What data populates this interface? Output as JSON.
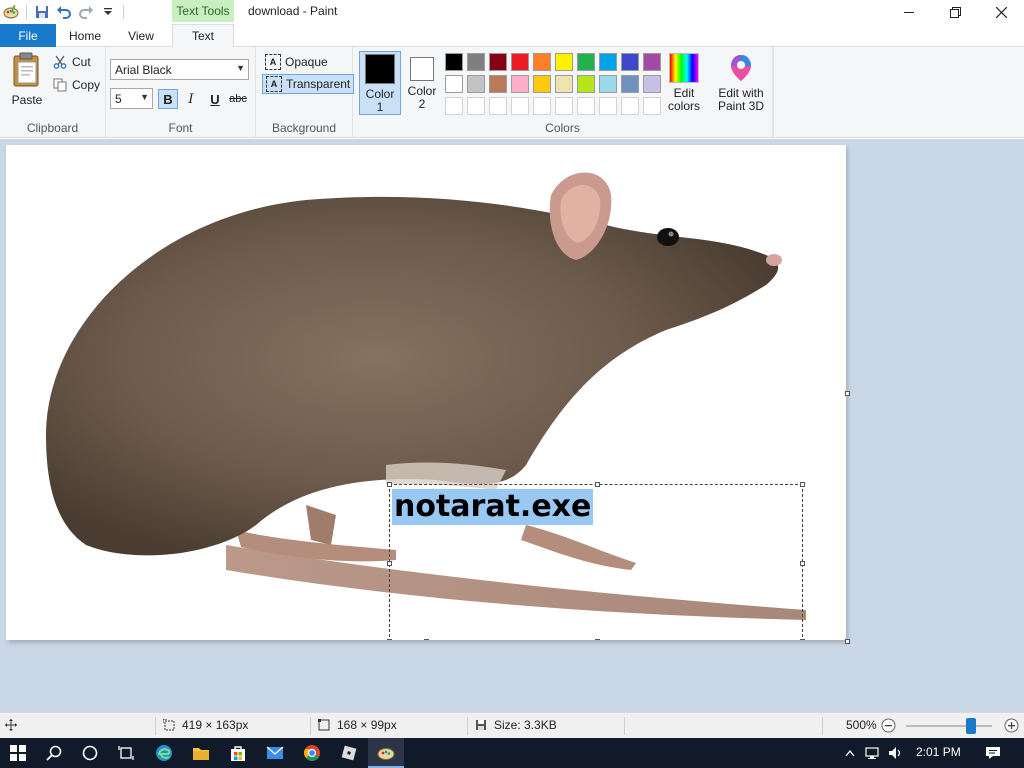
{
  "window": {
    "title": "download - Paint",
    "context_tab_header": "Text Tools"
  },
  "tabs": {
    "file": "File",
    "home": "Home",
    "view": "View",
    "text": "Text"
  },
  "clipboard": {
    "paste": "Paste",
    "cut": "Cut",
    "copy": "Copy",
    "label": "Clipboard"
  },
  "font": {
    "family": "Arial Black",
    "size": "5",
    "bold": "B",
    "italic": "I",
    "underline": "U",
    "strikethrough": "abc",
    "label": "Font"
  },
  "background": {
    "opaque": "Opaque",
    "transparent": "Transparent",
    "label": "Background"
  },
  "colors": {
    "color1_label_line1": "Color",
    "color1_label_line2": "1",
    "color2_label_line1": "Color",
    "color2_label_line2": "2",
    "color1_value": "#000000",
    "color2_value": "#ffffff",
    "palette": [
      "#000000",
      "#7f7f7f",
      "#880015",
      "#ed1c24",
      "#ff7f27",
      "#fff200",
      "#22b14c",
      "#00a2e8",
      "#3f48cc",
      "#a349a4",
      "#ffffff",
      "#c3c3c3",
      "#b97a57",
      "#ffaec9",
      "#ffc90e",
      "#efe4b0",
      "#b5e61d",
      "#99d9ea",
      "#7092be",
      "#c8bfe7"
    ],
    "empty_slots": 10,
    "edit_colors_line1": "Edit",
    "edit_colors_line2": "colors",
    "label": "Colors"
  },
  "paint3d": {
    "line1": "Edit with",
    "line2": "Paint 3D"
  },
  "canvas": {
    "text": "notarat.exe",
    "body_color": "#6b5a4b"
  },
  "status": {
    "cursor_pos": "",
    "selection_size": "419 × 163px",
    "canvas_size": "168 × 99px",
    "file_size": "Size: 3.3KB",
    "zoom": "500%"
  },
  "taskbar": {
    "time": "2:01 PM"
  }
}
